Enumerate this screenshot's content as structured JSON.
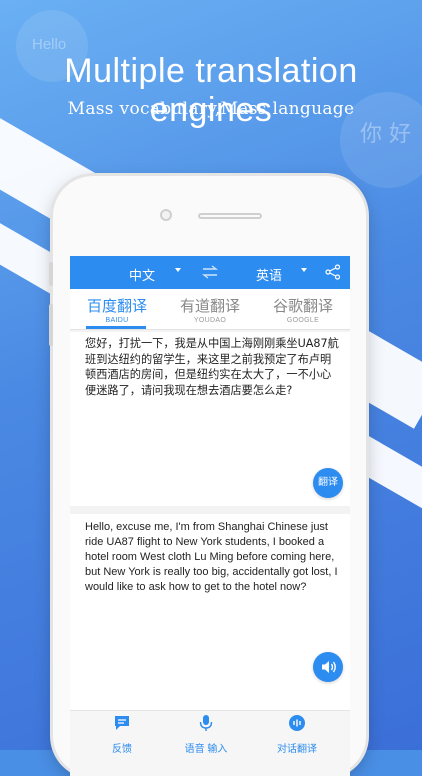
{
  "promo": {
    "headline": "Multiple translation engines",
    "subhead": "Mass vocabulary,Mass language",
    "bubble_left": "Hello",
    "bubble_right": "你 好"
  },
  "colors": {
    "accent": "#2d8cf0",
    "background": "#4a8fe6"
  },
  "topbar": {
    "source_language": "中文",
    "target_language": "英语",
    "swap_icon": "swap-arrows-icon",
    "share_icon": "share-icon"
  },
  "tabs": [
    {
      "label": "百度翻译",
      "sublabel": "BAIDU",
      "active": true
    },
    {
      "label": "有道翻译",
      "sublabel": "YOUDAO",
      "active": false
    },
    {
      "label": "谷歌翻译",
      "sublabel": "GOOGLE",
      "active": false
    }
  ],
  "source": {
    "text": "您好，打扰一下，我是从中国上海刚刚乘坐UA87航班到达纽约的留学生，来这里之前我预定了布卢明顿西酒店的房间，但是纽约实在太大了，一不小心便迷路了，请问我现在想去酒店要怎么走?",
    "translate_button": "翻译"
  },
  "result": {
    "text": "Hello, excuse me, I'm from Shanghai Chinese just ride UA87 flight to New York students, I booked a hotel room West cloth Lu Ming before coming here, but New York is really too big, accidentally got lost, I would like to ask how to get to the hotel now?",
    "speaker_icon": "speaker-icon"
  },
  "bottom_nav": [
    {
      "label": "反馈",
      "icon": "feedback-icon"
    },
    {
      "label": "语音 输入",
      "icon": "microphone-icon"
    },
    {
      "label": "对话翻译",
      "icon": "conversation-icon"
    }
  ]
}
